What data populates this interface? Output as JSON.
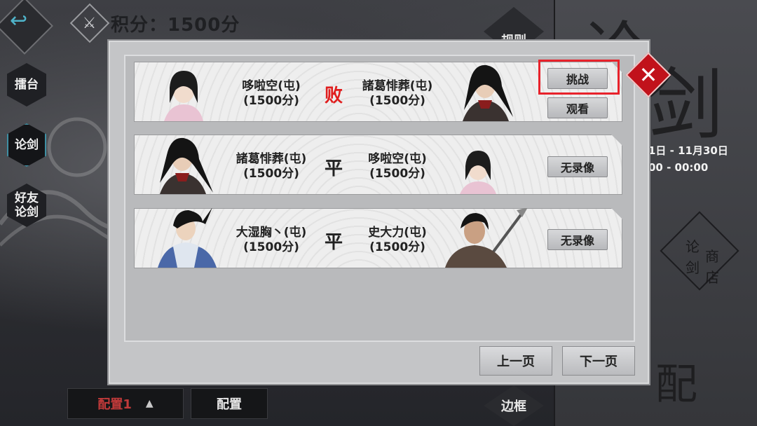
{
  "header": {
    "score_label": "积分：1500分"
  },
  "side_tabs": [
    {
      "label": "擂台"
    },
    {
      "label": "论剑"
    },
    {
      "label": "好友\n论剑"
    }
  ],
  "right_panel": {
    "rule_label": "规则",
    "big_chars": [
      "论",
      "剑"
    ],
    "date_line1": "1日 - 11月30日",
    "date_line2": "00 - 00:00",
    "shop_chars": [
      "论",
      "剑",
      "商",
      "店"
    ],
    "config_char": "配"
  },
  "bottom": {
    "loadout_label": "配置1",
    "config_label": "配置",
    "border_label": "边框"
  },
  "records": [
    {
      "left_name": "哆啦空(屯)",
      "left_score": "(1500分)",
      "result": "败",
      "result_color": "#e01d1d",
      "right_name": "諸葛悱葬(屯)",
      "right_score": "(1500分)",
      "buttons": [
        "挑战",
        "观看"
      ]
    },
    {
      "left_name": "諸葛悱葬(屯)",
      "left_score": "(1500分)",
      "result": "平",
      "result_color": "#222222",
      "right_name": "哆啦空(屯)",
      "right_score": "(1500分)",
      "buttons": [
        "无录像"
      ]
    },
    {
      "left_name": "大湿胸丶(屯)",
      "left_score": "(1500分)",
      "result": "平",
      "result_color": "#222222",
      "right_name": "史大力(屯)",
      "right_score": "(1500分)",
      "buttons": [
        "无录像"
      ]
    }
  ],
  "pagination": {
    "prev": "上一页",
    "next": "下一页"
  },
  "icons": {
    "back": "back-arrow-icon",
    "score": "crossed-swords-icon",
    "close": "close-icon"
  },
  "colors": {
    "close_red": "#c1121b",
    "highlight_red": "#e8222b",
    "accent_teal": "#4fb3c9"
  }
}
